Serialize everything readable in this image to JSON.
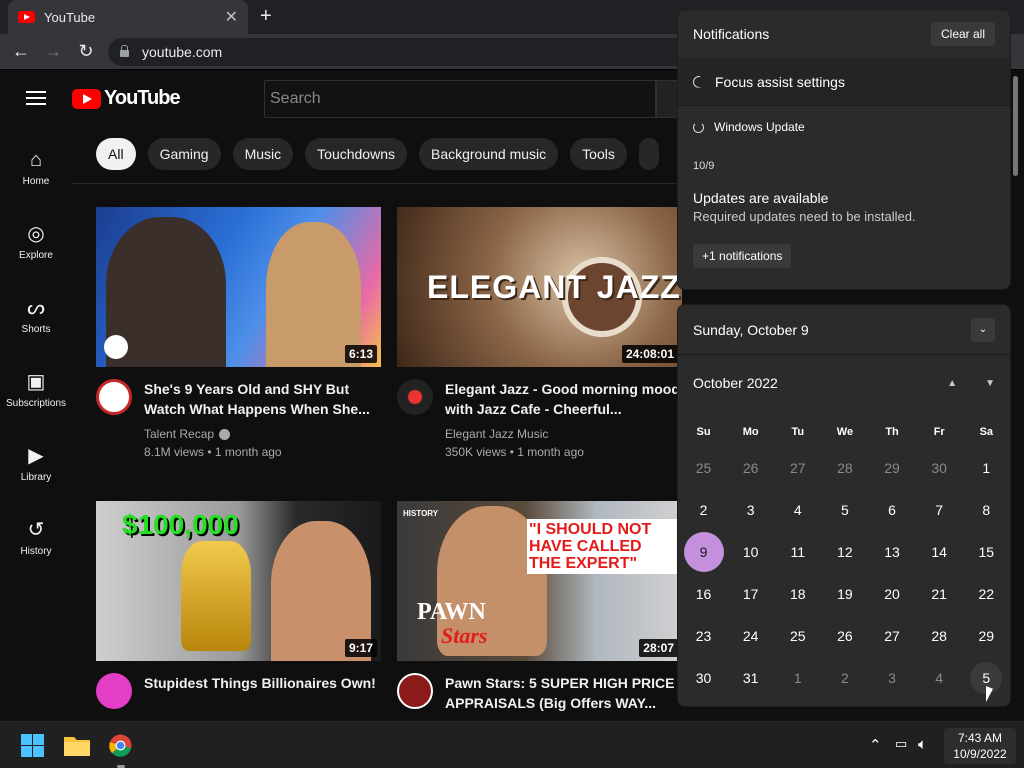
{
  "browser": {
    "tab_title": "YouTube",
    "tab_close": "✕",
    "new_tab": "+",
    "back": "←",
    "forward": "→",
    "reload": "↻",
    "url": "youtube.com"
  },
  "youtube": {
    "logo_text": "YouTube",
    "search_placeholder": "Search",
    "sidebar": [
      {
        "label": "Home",
        "icon": "⌂"
      },
      {
        "label": "Explore",
        "icon": "◎"
      },
      {
        "label": "Shorts",
        "icon": "ᔕ"
      },
      {
        "label": "Subscriptions",
        "icon": "▣"
      },
      {
        "label": "Library",
        "icon": "▶"
      },
      {
        "label": "History",
        "icon": "↺"
      }
    ],
    "chips": [
      "All",
      "Gaming",
      "Music",
      "Touchdowns",
      "Background music",
      "Tools"
    ],
    "videos": [
      {
        "title": "She's 9 Years Old and SHY But Watch What Happens When She...",
        "channel": "Talent Recap",
        "verified": true,
        "views": "8.1M views • 1 month ago",
        "duration": "6:13"
      },
      {
        "title": "Elegant Jazz - Good morning mood with Jazz Cafe - Cheerful...",
        "channel": "Elegant Jazz Music",
        "views": "350K views • 1 month ago",
        "duration": "24:08:01",
        "thumb_text": "ELEGANT JAZZ"
      },
      {
        "title": "Stupidest Things Billionaires Own!",
        "channel": "",
        "views": "",
        "duration": "9:17",
        "thumb_text": "$100,000"
      },
      {
        "title": "Pawn Stars: 5 SUPER HIGH PRICE APPRAISALS (Big Offers WAY...",
        "channel": "",
        "views": "",
        "duration": "28:07",
        "thumb_text": "\"I SHOULD NOT HAVE CALLED THE EXPERT\"",
        "thumb_text2": "PAWN",
        "thumb_text3": "Stars",
        "thumb_badge": "HISTORY"
      }
    ]
  },
  "notifications": {
    "title": "Notifications",
    "clear_all": "Clear all",
    "focus_assist": "Focus assist settings",
    "source": "Windows Update",
    "date": "10/9",
    "update_title": "Updates are available",
    "update_text": "Required updates need to be installed.",
    "more": "+1 notifications"
  },
  "calendar": {
    "header_date": "Sunday, October 9",
    "month": "October 2022",
    "weekdays": [
      "Su",
      "Mo",
      "Tu",
      "We",
      "Th",
      "Fr",
      "Sa"
    ],
    "weeks": [
      [
        "25",
        "26",
        "27",
        "28",
        "29",
        "30",
        "1"
      ],
      [
        "2",
        "3",
        "4",
        "5",
        "6",
        "7",
        "8"
      ],
      [
        "9",
        "10",
        "11",
        "12",
        "13",
        "14",
        "15"
      ],
      [
        "16",
        "17",
        "18",
        "19",
        "20",
        "21",
        "22"
      ],
      [
        "23",
        "24",
        "25",
        "26",
        "27",
        "28",
        "29"
      ],
      [
        "30",
        "31",
        "1",
        "2",
        "3",
        "4",
        "5"
      ]
    ],
    "today": "9"
  },
  "taskbar": {
    "time": "7:43 AM",
    "date": "10/9/2022"
  }
}
